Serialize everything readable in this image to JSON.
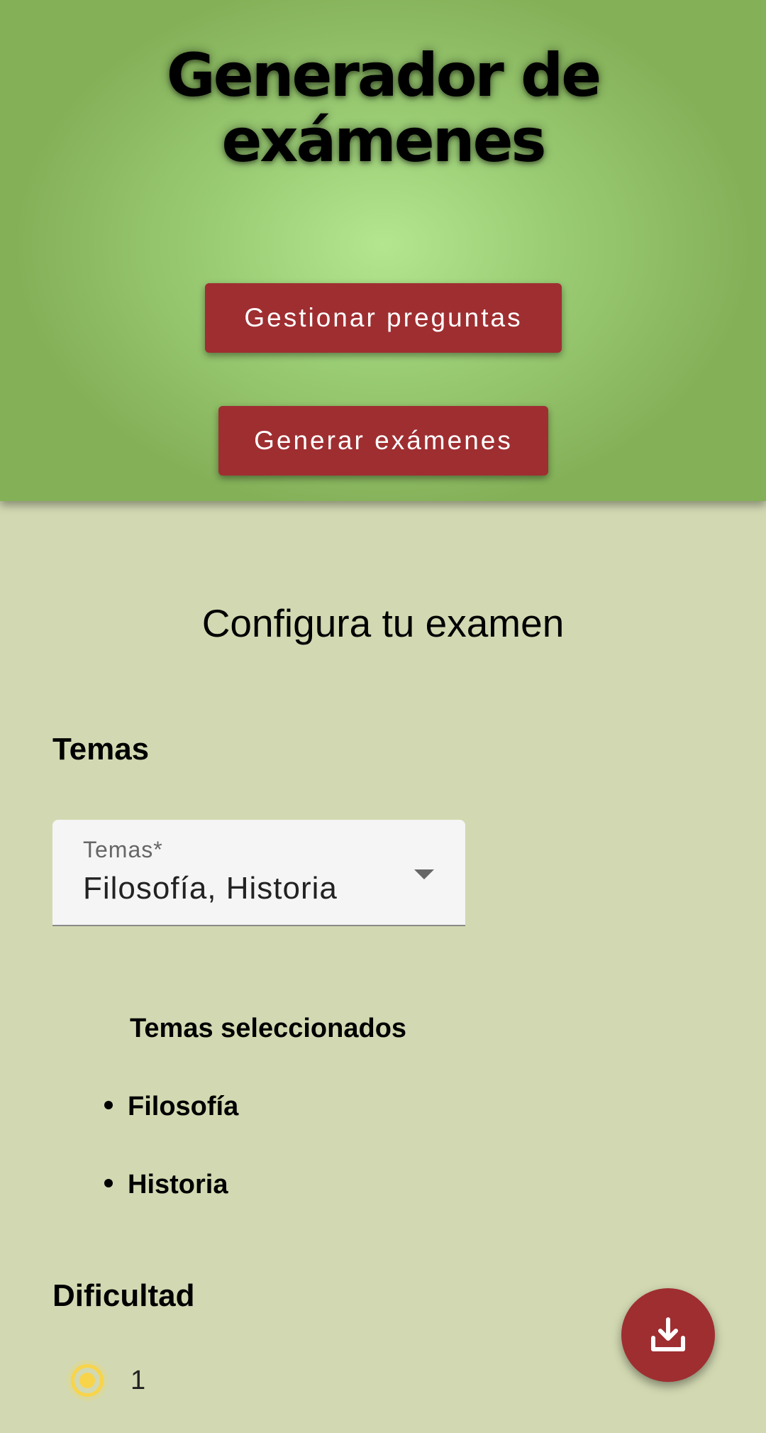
{
  "header": {
    "title": "Generador de exámenes",
    "manage_button": "Gestionar preguntas",
    "generate_button": "Generar exámenes"
  },
  "main": {
    "section_title": "Configura tu examen",
    "topics_heading": "Temas",
    "topics_select": {
      "label": "Temas*",
      "value": "Filosofía, Historia",
      "icon": "dropdown-arrow-icon"
    },
    "selected_topics_title": "Temas seleccionados",
    "selected_topics": [
      "Filosofía",
      "Historia"
    ],
    "difficulty_heading": "Dificultad",
    "difficulty_options": [
      {
        "label": "1",
        "selected": true
      }
    ]
  },
  "fab": {
    "icon": "download-icon",
    "color": "#9f2e31"
  },
  "colors": {
    "accent": "#9f2e31",
    "header_bg": "#9bcd75",
    "page_bg": "#d2d9b2",
    "radio": "#f8d44a"
  }
}
